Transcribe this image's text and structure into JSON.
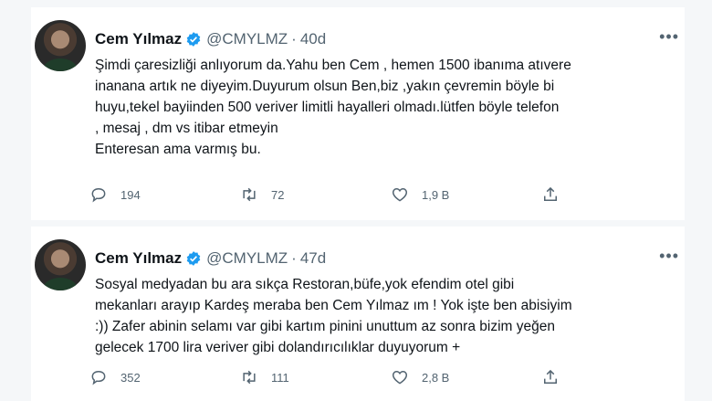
{
  "tweets": [
    {
      "name": "Cem Yılmaz",
      "handle": "@CMYLMZ",
      "separator": "·",
      "time": "40d",
      "text": "Şimdi çaresizliği anlıyorum da.Yahu ben Cem , hemen 1500 ibanıma atıvere\ninanana artık ne diyeyim.Duyurum olsun Ben,biz ,yakın çevremin böyle bi\nhuyu,tekel bayiinden 500 veriver limitli hayalleri olmadı.lütfen böyle telefon\n, mesaj , dm  vs itibar etmeyin\nEnteresan ama varmış bu.",
      "replies": "194",
      "retweets": "72",
      "likes": "1,9 B"
    },
    {
      "name": "Cem Yılmaz",
      "handle": "@CMYLMZ",
      "separator": "·",
      "time": "47d",
      "text": "Sosyal medyadan bu ara sıkça Restoran,büfe,yok efendim otel gibi\nmekanları arayıp Kardeş meraba ben Cem Yılmaz ım ! Yok işte ben abisiyim\n:)) Zafer abinin selamı var gibi kartım pinini unuttum az sonra bizim yeğen\ngelecek 1700 lira veriver gibi dolandırıcılıklar  duyuyorum +",
      "replies": "352",
      "retweets": "111",
      "likes": "2,8 B"
    }
  ],
  "icons": {
    "verified": "verified-badge-icon",
    "more": "more-options-icon",
    "reply": "reply-icon",
    "retweet": "retweet-icon",
    "like": "like-icon",
    "share": "share-icon"
  },
  "colors": {
    "verified": "#1d9bf0",
    "secondary": "#536471",
    "text": "#0f1419"
  }
}
